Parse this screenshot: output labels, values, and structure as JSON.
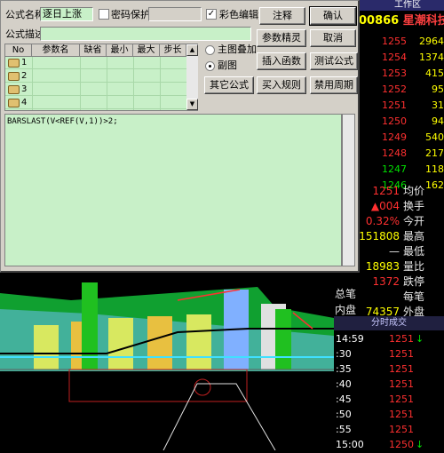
{
  "dialog": {
    "name_label": "公式名称",
    "name_value": "逐日上涨",
    "password_label": "密码保护",
    "password_checked": false,
    "color_edit_label": "彩色编辑",
    "color_edit_checked": true,
    "desc_label": "公式描述",
    "desc_value": "",
    "buttons": {
      "annotate": "注释",
      "confirm": "确认",
      "param_wizard": "参数精灵",
      "cancel": "取消",
      "insert_func": "插入函数",
      "test_formula": "测试公式",
      "other_formula": "其它公式",
      "buy_rule": "买入规则",
      "disable_period": "禁用周期"
    },
    "radios": {
      "main_overlay": "主图叠加",
      "sub_chart": "副图",
      "selected": "sub_chart"
    },
    "param_table": {
      "headers": [
        "No",
        "参数名",
        "缺省",
        "最小",
        "最大",
        "步长"
      ],
      "rows": [
        "1",
        "2",
        "3",
        "4"
      ]
    },
    "formula_text": "BARSLAST(V<REF(V,1))>2;"
  },
  "terminal": {
    "topbar": "工作区",
    "stock_code": "00866",
    "stock_name": "星潮科技",
    "orderbook": [
      {
        "price": "1255",
        "vol": "2964",
        "color": "red"
      },
      {
        "price": "1254",
        "vol": "1374",
        "color": "red"
      },
      {
        "price": "1253",
        "vol": "415",
        "color": "red"
      },
      {
        "price": "1252",
        "vol": "95",
        "color": "red"
      },
      {
        "price": "1251",
        "vol": "31",
        "color": "red"
      },
      {
        "price": "1250",
        "vol": "94",
        "color": "red"
      },
      {
        "price": "1249",
        "vol": "540",
        "color": "red"
      },
      {
        "price": "1248",
        "vol": "217",
        "color": "red"
      },
      {
        "price": "1247",
        "vol": "118",
        "color": "green"
      },
      {
        "price": "1246",
        "vol": "162",
        "color": "green"
      }
    ],
    "stats": [
      {
        "value": "1251",
        "label": "均价",
        "color": "#ff3030"
      },
      {
        "value": "▲004",
        "label": "换手",
        "color": "#ff3030"
      },
      {
        "value": "0.32%",
        "label": "今开",
        "color": "#ff3030"
      },
      {
        "value": "151808",
        "label": "最高",
        "color": "#ffff00"
      },
      {
        "value": "—",
        "label": "最低",
        "color": "#e8e8e8"
      },
      {
        "value": "18983",
        "label": "量比",
        "color": "#ffff00"
      },
      {
        "value": "1372",
        "label": "跌停",
        "color": "#ff3030"
      },
      {
        "value": "",
        "label": "每笔",
        "color": "#e8e8e8"
      },
      {
        "value": "74357",
        "label": "外盘",
        "color": "#ffff00"
      }
    ],
    "left_labels": [
      "总笔",
      "内盘"
    ],
    "trades_header": "分时成交",
    "trades": [
      {
        "time": "14:59",
        "price": "1251",
        "arrow": "↓"
      },
      {
        "time": ":30",
        "price": "1251",
        "arrow": ""
      },
      {
        "time": ":35",
        "price": "1251",
        "arrow": ""
      },
      {
        "time": ":40",
        "price": "1251",
        "arrow": ""
      },
      {
        "time": ":45",
        "price": "1251",
        "arrow": ""
      },
      {
        "time": ":50",
        "price": "1251",
        "arrow": ""
      },
      {
        "time": ":55",
        "price": "1251",
        "arrow": ""
      },
      {
        "time": "15:00",
        "price": "1250",
        "arrow": "↓"
      }
    ]
  }
}
